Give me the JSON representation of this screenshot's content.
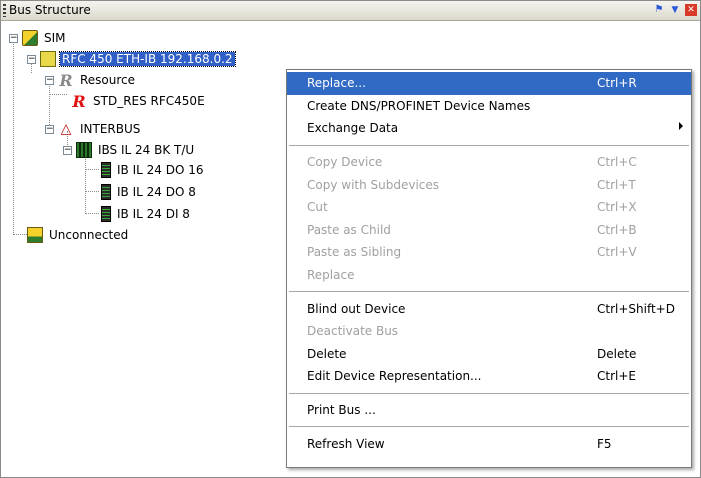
{
  "panel": {
    "title": "Bus Structure",
    "icons": [
      "pin-icon",
      "dropdown-icon",
      "close-icon"
    ]
  },
  "tree": {
    "sim": "SIM",
    "rfc": "RFC 450 ETH-IB 192.168.0.2",
    "resource": "Resource",
    "std_res": "STD_RES RFC450E",
    "interbus": "INTERBUS",
    "ibs": "IBS IL 24 BK T/U",
    "do16": "IB IL 24 DO 16",
    "do8": "IB IL 24 DO 8",
    "di8": "IB IL 24 DI 8",
    "unconnected": "Unconnected"
  },
  "menu": {
    "items": [
      {
        "label": "Replace...",
        "shortcut": "Ctrl+R",
        "state": "highlighted"
      },
      {
        "label": "Create DNS/PROFINET Device Names",
        "shortcut": "",
        "state": "enabled"
      },
      {
        "label": "Exchange Data",
        "shortcut": "",
        "state": "enabled",
        "submenu": true
      },
      {
        "label": "Copy Device",
        "shortcut": "Ctrl+C",
        "state": "disabled"
      },
      {
        "label": "Copy with Subdevices",
        "shortcut": "Ctrl+T",
        "state": "disabled"
      },
      {
        "label": "Cut",
        "shortcut": "Ctrl+X",
        "state": "disabled"
      },
      {
        "label": "Paste as Child",
        "shortcut": "Ctrl+B",
        "state": "disabled"
      },
      {
        "label": "Paste as Sibling",
        "shortcut": "Ctrl+V",
        "state": "disabled"
      },
      {
        "label": "Replace",
        "shortcut": "",
        "state": "disabled"
      },
      {
        "label": "Blind out Device",
        "shortcut": "Ctrl+Shift+D",
        "state": "enabled"
      },
      {
        "label": "Deactivate Bus",
        "shortcut": "",
        "state": "disabled"
      },
      {
        "label": "Delete",
        "shortcut": "Delete",
        "state": "enabled"
      },
      {
        "label": "Edit Device Representation...",
        "shortcut": "Ctrl+E",
        "state": "enabled"
      },
      {
        "label": "Print Bus ...",
        "shortcut": "",
        "state": "enabled"
      },
      {
        "label": "Refresh View",
        "shortcut": "F5",
        "state": "enabled"
      }
    ]
  },
  "colors": {
    "highlight": "#316ac5",
    "selection": "#2f5fc7",
    "disabled_text": "#a0a0a0"
  }
}
